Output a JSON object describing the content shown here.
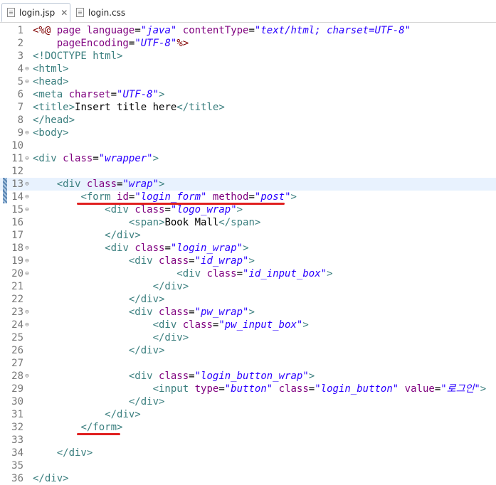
{
  "tabs": [
    {
      "label": "login.jsp",
      "active": true,
      "close": "✕"
    },
    {
      "label": "login.css",
      "active": false
    }
  ],
  "editor": {
    "current_line": 13,
    "lines": [
      {
        "n": "1",
        "fold": false,
        "segs": [
          [
            "d",
            "<%@ "
          ],
          [
            "a",
            "page "
          ],
          [
            "a",
            "language"
          ],
          [
            "x",
            "="
          ],
          [
            "v",
            "\"java\""
          ],
          [
            "x",
            " "
          ],
          [
            "a",
            "contentType"
          ],
          [
            "x",
            "="
          ],
          [
            "v",
            "\"text/html; charset=UTF-8\""
          ]
        ]
      },
      {
        "n": "2",
        "fold": false,
        "segs": [
          [
            "x",
            "    "
          ],
          [
            "a",
            "pageEncoding"
          ],
          [
            "x",
            "="
          ],
          [
            "v",
            "\"UTF-8\""
          ],
          [
            "d",
            "%>"
          ]
        ]
      },
      {
        "n": "3",
        "fold": false,
        "segs": [
          [
            "t",
            "<!DOCTYPE html>"
          ]
        ]
      },
      {
        "n": "4",
        "fold": true,
        "segs": [
          [
            "t",
            "<html>"
          ]
        ]
      },
      {
        "n": "5",
        "fold": true,
        "segs": [
          [
            "t",
            "<head>"
          ]
        ]
      },
      {
        "n": "6",
        "fold": false,
        "segs": [
          [
            "t",
            "<meta "
          ],
          [
            "a",
            "charset"
          ],
          [
            "x",
            "="
          ],
          [
            "v",
            "\"UTF-8\""
          ],
          [
            "t",
            ">"
          ]
        ]
      },
      {
        "n": "7",
        "fold": false,
        "segs": [
          [
            "t",
            "<title>"
          ],
          [
            "x",
            "Insert title here"
          ],
          [
            "t",
            "</title>"
          ]
        ]
      },
      {
        "n": "8",
        "fold": false,
        "segs": [
          [
            "t",
            "</head>"
          ]
        ]
      },
      {
        "n": "9",
        "fold": true,
        "segs": [
          [
            "t",
            "<body>"
          ]
        ]
      },
      {
        "n": "10",
        "fold": false,
        "segs": []
      },
      {
        "n": "11",
        "fold": true,
        "segs": [
          [
            "t",
            "<div "
          ],
          [
            "a",
            "class"
          ],
          [
            "x",
            "="
          ],
          [
            "v",
            "\"wrapper\""
          ],
          [
            "t",
            ">"
          ]
        ]
      },
      {
        "n": "12",
        "fold": false,
        "segs": []
      },
      {
        "n": "13",
        "fold": true,
        "segs": [
          [
            "x",
            "    "
          ],
          [
            "t",
            "<div "
          ],
          [
            "a",
            "class"
          ],
          [
            "x",
            "="
          ],
          [
            "v",
            "\"wrap\""
          ],
          [
            "t",
            ">"
          ]
        ]
      },
      {
        "n": "14",
        "fold": true,
        "segs": [
          [
            "x",
            "        "
          ],
          [
            "t",
            "<form "
          ],
          [
            "a",
            "id"
          ],
          [
            "x",
            "="
          ],
          [
            "v",
            "\"login_form\""
          ],
          [
            "x",
            " "
          ],
          [
            "a",
            "method"
          ],
          [
            "x",
            "="
          ],
          [
            "v",
            "\"post\""
          ],
          [
            "t",
            ">"
          ]
        ]
      },
      {
        "n": "15",
        "fold": true,
        "segs": [
          [
            "x",
            "            "
          ],
          [
            "t",
            "<div "
          ],
          [
            "a",
            "class"
          ],
          [
            "x",
            "="
          ],
          [
            "v",
            "\"logo_wrap\""
          ],
          [
            "t",
            ">"
          ]
        ]
      },
      {
        "n": "16",
        "fold": false,
        "segs": [
          [
            "x",
            "                "
          ],
          [
            "t",
            "<span>"
          ],
          [
            "x",
            "Book Mall"
          ],
          [
            "t",
            "</span>"
          ]
        ]
      },
      {
        "n": "17",
        "fold": false,
        "segs": [
          [
            "x",
            "            "
          ],
          [
            "t",
            "</div>"
          ]
        ]
      },
      {
        "n": "18",
        "fold": true,
        "segs": [
          [
            "x",
            "            "
          ],
          [
            "t",
            "<div "
          ],
          [
            "a",
            "class"
          ],
          [
            "x",
            "="
          ],
          [
            "v",
            "\"login_wrap\""
          ],
          [
            "t",
            ">"
          ]
        ]
      },
      {
        "n": "19",
        "fold": true,
        "segs": [
          [
            "x",
            "                "
          ],
          [
            "t",
            "<div "
          ],
          [
            "a",
            "class"
          ],
          [
            "x",
            "="
          ],
          [
            "v",
            "\"id_wrap\""
          ],
          [
            "t",
            ">"
          ]
        ]
      },
      {
        "n": "20",
        "fold": true,
        "segs": [
          [
            "x",
            "                        "
          ],
          [
            "t",
            "<div "
          ],
          [
            "a",
            "class"
          ],
          [
            "x",
            "="
          ],
          [
            "v",
            "\"id_input_box\""
          ],
          [
            "t",
            ">"
          ]
        ]
      },
      {
        "n": "21",
        "fold": false,
        "segs": [
          [
            "x",
            "                    "
          ],
          [
            "t",
            "</div>"
          ]
        ]
      },
      {
        "n": "22",
        "fold": false,
        "segs": [
          [
            "x",
            "                "
          ],
          [
            "t",
            "</div>"
          ]
        ]
      },
      {
        "n": "23",
        "fold": true,
        "segs": [
          [
            "x",
            "                "
          ],
          [
            "t",
            "<div "
          ],
          [
            "a",
            "class"
          ],
          [
            "x",
            "="
          ],
          [
            "v",
            "\"pw_wrap\""
          ],
          [
            "t",
            ">"
          ]
        ]
      },
      {
        "n": "24",
        "fold": true,
        "segs": [
          [
            "x",
            "                    "
          ],
          [
            "t",
            "<div "
          ],
          [
            "a",
            "class"
          ],
          [
            "x",
            "="
          ],
          [
            "v",
            "\"pw_input_box\""
          ],
          [
            "t",
            ">"
          ]
        ]
      },
      {
        "n": "25",
        "fold": false,
        "segs": [
          [
            "x",
            "                    "
          ],
          [
            "t",
            "</div>"
          ]
        ]
      },
      {
        "n": "26",
        "fold": false,
        "segs": [
          [
            "x",
            "                "
          ],
          [
            "t",
            "</div>"
          ]
        ]
      },
      {
        "n": "27",
        "fold": false,
        "segs": []
      },
      {
        "n": "28",
        "fold": true,
        "segs": [
          [
            "x",
            "                "
          ],
          [
            "t",
            "<div "
          ],
          [
            "a",
            "class"
          ],
          [
            "x",
            "="
          ],
          [
            "v",
            "\"login_button_wrap\""
          ],
          [
            "t",
            ">"
          ]
        ]
      },
      {
        "n": "29",
        "fold": false,
        "segs": [
          [
            "x",
            "                    "
          ],
          [
            "t",
            "<input "
          ],
          [
            "a",
            "type"
          ],
          [
            "x",
            "="
          ],
          [
            "v",
            "\"button\""
          ],
          [
            "x",
            " "
          ],
          [
            "a",
            "class"
          ],
          [
            "x",
            "="
          ],
          [
            "v",
            "\"login_button\""
          ],
          [
            "x",
            " "
          ],
          [
            "a",
            "value"
          ],
          [
            "x",
            "="
          ],
          [
            "v",
            "\"로그인\""
          ],
          [
            "t",
            ">"
          ]
        ]
      },
      {
        "n": "30",
        "fold": false,
        "segs": [
          [
            "x",
            "                "
          ],
          [
            "t",
            "</div>"
          ]
        ]
      },
      {
        "n": "31",
        "fold": false,
        "segs": [
          [
            "x",
            "            "
          ],
          [
            "t",
            "</div>"
          ]
        ]
      },
      {
        "n": "32",
        "fold": false,
        "segs": [
          [
            "x",
            "        "
          ],
          [
            "t",
            "</form>"
          ]
        ]
      },
      {
        "n": "33",
        "fold": false,
        "segs": []
      },
      {
        "n": "34",
        "fold": false,
        "segs": [
          [
            "x",
            "    "
          ],
          [
            "t",
            "</div>"
          ]
        ]
      },
      {
        "n": "35",
        "fold": false,
        "segs": []
      },
      {
        "n": "36",
        "fold": false,
        "segs": [
          [
            "t",
            "</div>"
          ]
        ]
      }
    ]
  },
  "colors": {
    "tag": "#3b7f7f",
    "attribute": "#7f007f",
    "value": "#2a00ff",
    "directive": "#800000",
    "text": "#000000",
    "annotation": "#e02020"
  }
}
